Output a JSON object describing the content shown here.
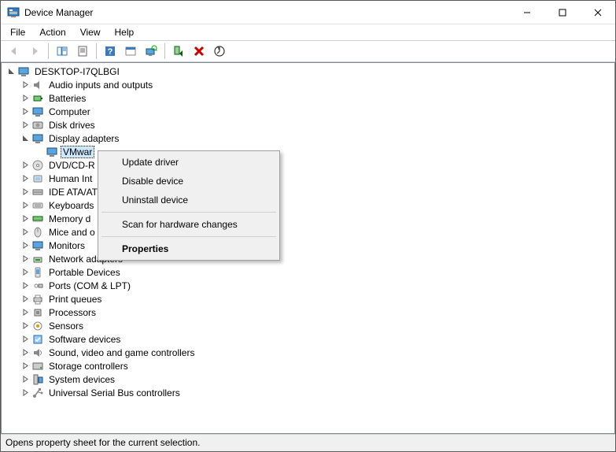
{
  "title": "Device Manager",
  "menubar": [
    "File",
    "Action",
    "View",
    "Help"
  ],
  "status": "Opens property sheet for the current selection.",
  "root_name": "DESKTOP-I7QLBGI",
  "selected_device": "VMwar",
  "context_menu": {
    "update": "Update driver",
    "disable": "Disable device",
    "uninstall": "Uninstall device",
    "scan": "Scan for hardware changes",
    "properties": "Properties"
  },
  "categories": [
    {
      "name": "Audio inputs and outputs",
      "icon": "audio"
    },
    {
      "name": "Batteries",
      "icon": "battery"
    },
    {
      "name": "Computer",
      "icon": "computer"
    },
    {
      "name": "Disk drives",
      "icon": "disk"
    },
    {
      "name": "Display adapters",
      "icon": "display",
      "expanded": true
    },
    {
      "name": "DVD/CD-R",
      "icon": "dvd"
    },
    {
      "name": "Human Int",
      "icon": "hid"
    },
    {
      "name": "IDE ATA/AT",
      "icon": "ide"
    },
    {
      "name": "Keyboards",
      "icon": "keyboard"
    },
    {
      "name": "Memory d",
      "icon": "memory"
    },
    {
      "name": "Mice and o",
      "icon": "mouse"
    },
    {
      "name": "Monitors",
      "icon": "monitor"
    },
    {
      "name": "Network adapters",
      "icon": "network"
    },
    {
      "name": "Portable Devices",
      "icon": "portable"
    },
    {
      "name": "Ports (COM & LPT)",
      "icon": "port"
    },
    {
      "name": "Print queues",
      "icon": "printer"
    },
    {
      "name": "Processors",
      "icon": "cpu"
    },
    {
      "name": "Sensors",
      "icon": "sensor"
    },
    {
      "name": "Software devices",
      "icon": "software"
    },
    {
      "name": "Sound, video and game controllers",
      "icon": "sound"
    },
    {
      "name": "Storage controllers",
      "icon": "storage"
    },
    {
      "name": "System devices",
      "icon": "system"
    },
    {
      "name": "Universal Serial Bus controllers",
      "icon": "usb"
    }
  ]
}
